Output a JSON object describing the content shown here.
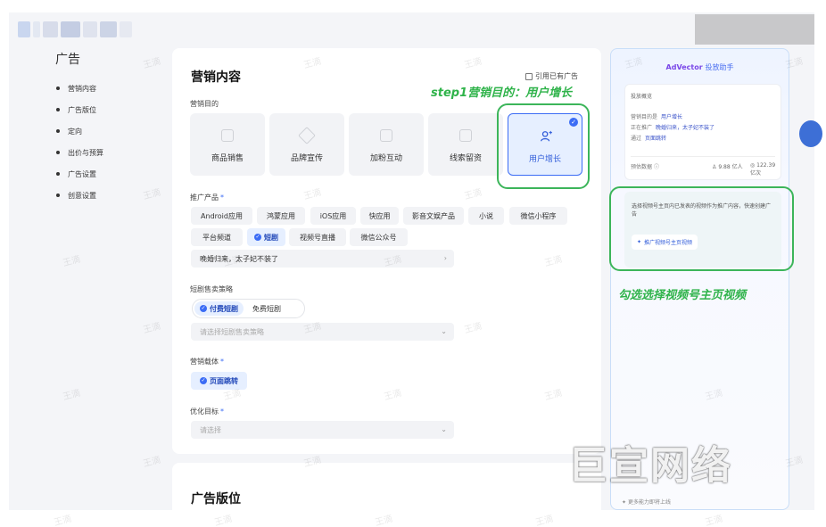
{
  "sidebar": {
    "title": "广告",
    "items": [
      "营销内容",
      "广告版位",
      "定向",
      "出价与预算",
      "广告设置",
      "创意设置"
    ]
  },
  "main": {
    "title": "营销内容",
    "cite_label": "引用已有广告",
    "goal_label": "营销目的",
    "goals": [
      "商品销售",
      "品牌宣传",
      "加粉互动",
      "线索留资",
      "用户增长"
    ],
    "product_label": "推广产品",
    "product_types": [
      "Android应用",
      "鸿蒙应用",
      "iOS应用",
      "快应用",
      "影音文娱产品",
      "小说",
      "微信小程序",
      "平台频道",
      "短剧",
      "视频号直播",
      "微信公众号"
    ],
    "product_value": "晚婚归来，太子妃不装了",
    "strategy_label": "短剧售卖策略",
    "strategy_options": [
      "付费短剧",
      "免费短剧"
    ],
    "strategy_placeholder": "请选择短剧售卖策略",
    "carrier_label": "营销载体",
    "carrier_value": "页面跳转",
    "opt_label": "优化目标",
    "opt_placeholder": "请选择",
    "section2_title": "广告版位"
  },
  "panel": {
    "title_brand": "AdVector",
    "title_sub": "投放助手",
    "overview_title": "投放概览",
    "goal_key": "营销目的是",
    "goal_val": "用户增长",
    "promo_key": "正在推广",
    "promo_val": "晚婚归来，太子妃不装了",
    "via_key": "通过",
    "via_val": "页面跳转",
    "est_label": "预估数据",
    "est_val1": "9.88 亿人",
    "est_val2": "122.39 亿次",
    "tip_text": "选择视频号主页内已发表的视频作为推广内容，快速创建广告",
    "tip_button": "推广视频号主页视频",
    "footer": "更多能力即将上线"
  },
  "annotations": {
    "step1": "step1营销目的：用户增长",
    "step2": "勾选选择视频号主页视频"
  },
  "watermark": {
    "text": "王滴",
    "brand": "巨宣网络"
  },
  "colors": {
    "accent": "#3b6cf5",
    "annotation_green": "#2fb34a"
  }
}
